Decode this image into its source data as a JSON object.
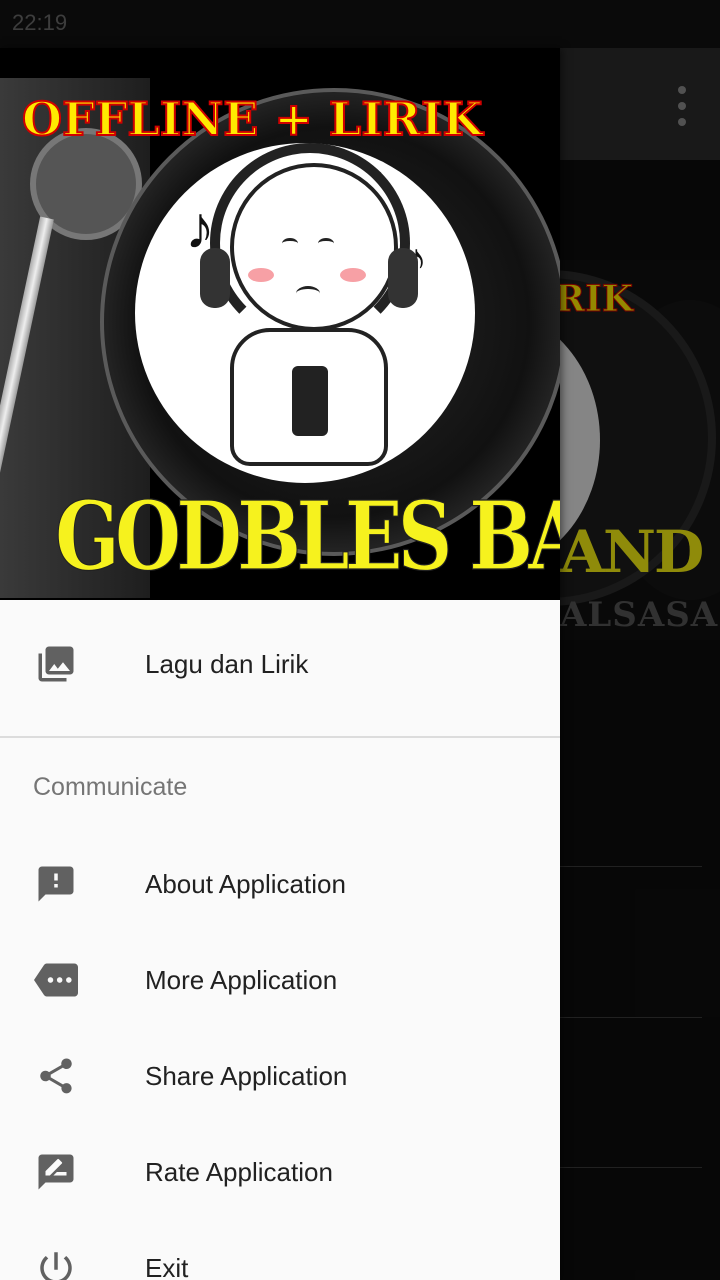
{
  "status_bar": {
    "time": "22:19"
  },
  "background_app": {
    "overflow_menu_icon": "more-vert-icon",
    "banner_title_fragment": "RIK",
    "banner_band_fragment": "AND",
    "banner_sub_fragment": "ALSASA"
  },
  "drawer": {
    "header": {
      "top_text": "OFFLINE + LIRIK",
      "band_name": "GODBLES BAND"
    },
    "primary_item": {
      "label": "Lagu dan Lirik",
      "icon": "photo-library-icon"
    },
    "section_title": "Communicate",
    "items": [
      {
        "label": "About Application",
        "icon": "feedback-icon"
      },
      {
        "label": "More Application",
        "icon": "more-label-icon"
      },
      {
        "label": "Share Application",
        "icon": "share-icon"
      },
      {
        "label": "Rate Application",
        "icon": "rate-review-icon"
      },
      {
        "label": "Exit",
        "icon": "power-icon"
      }
    ]
  },
  "colors": {
    "drawer_bg": "#fafafa",
    "icon_gray": "#616161",
    "text_primary": "#212121",
    "text_section": "#757575",
    "header_yellow": "#ffea00",
    "header_red": "#d00000"
  }
}
